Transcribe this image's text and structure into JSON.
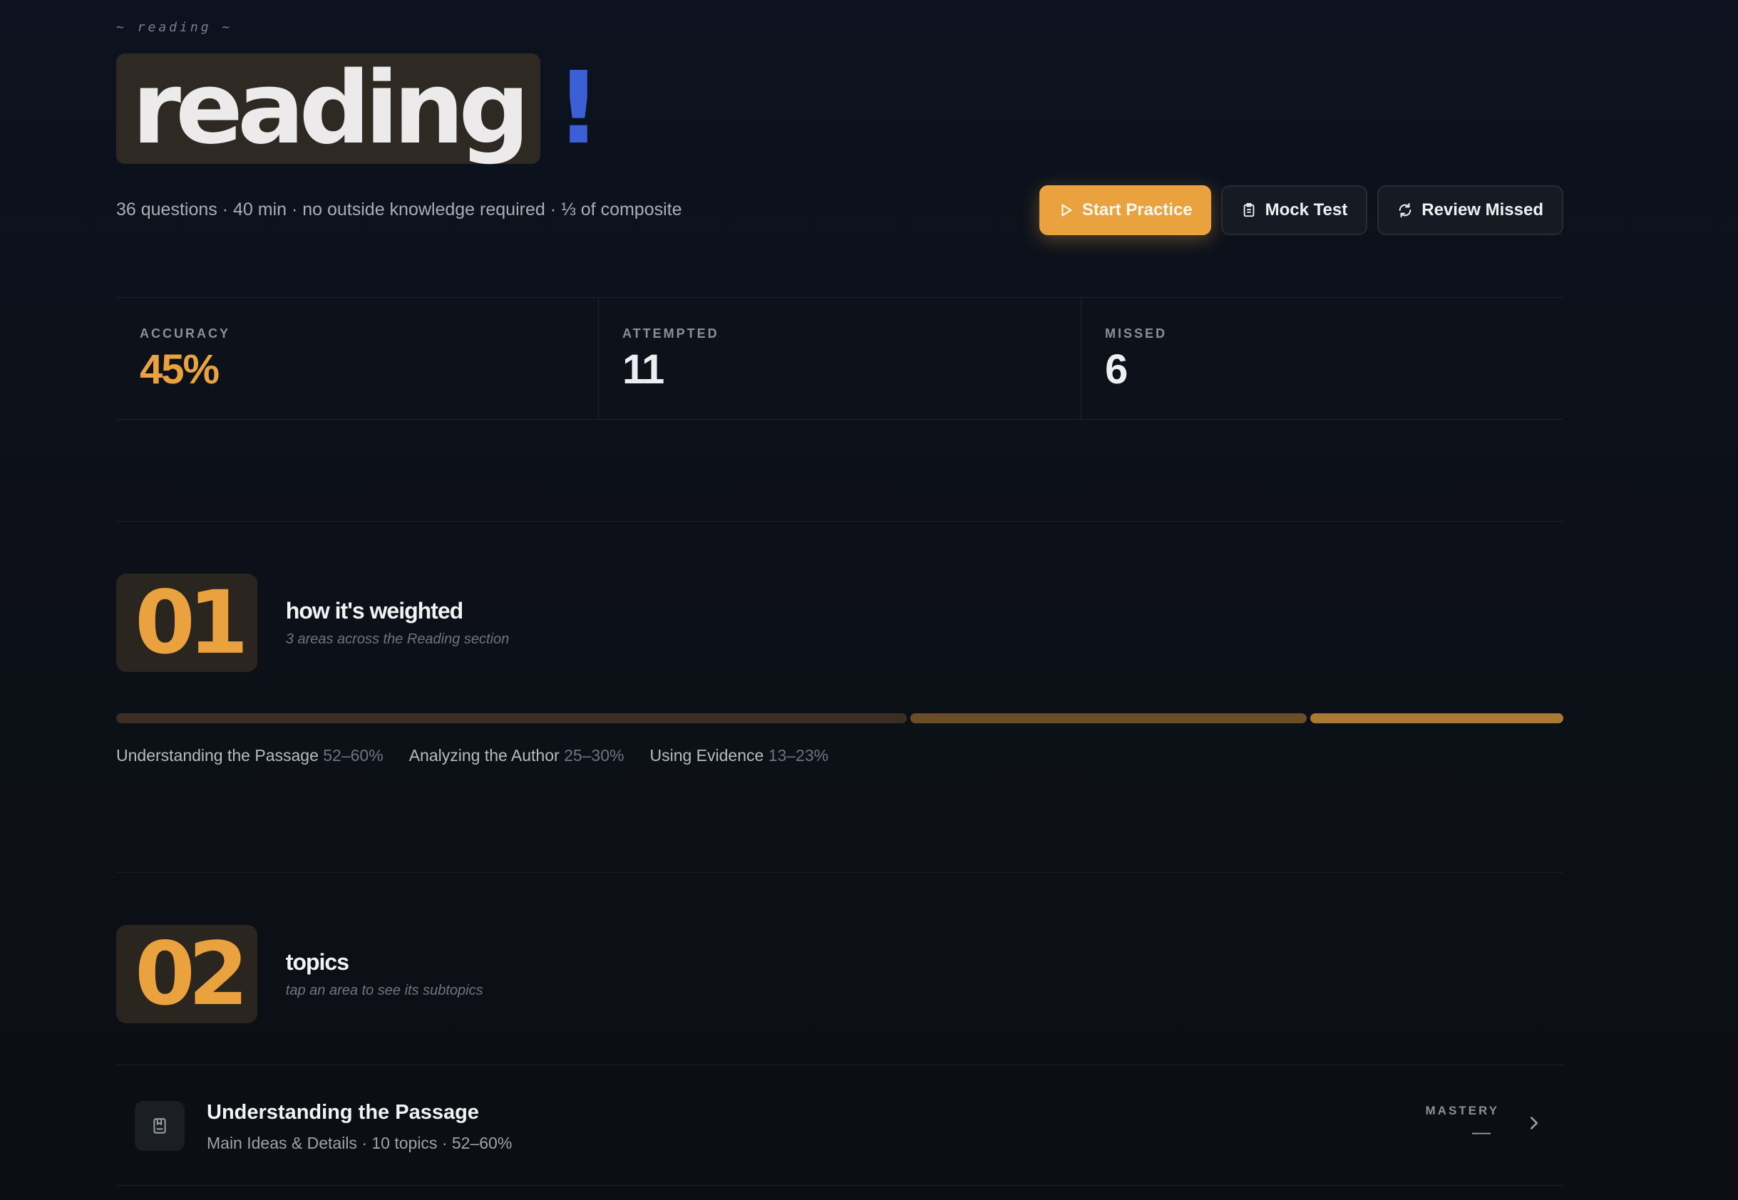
{
  "header": {
    "eyebrow": "~ reading ~",
    "title": "reading",
    "title_mark": "!",
    "meta": "36 questions · 40 min · no outside knowledge required · ⅓ of composite"
  },
  "actions": {
    "start_label": "Start Practice",
    "mock_label": "Mock Test",
    "review_label": "Review Missed"
  },
  "stats": {
    "accuracy_label": "ACCURACY",
    "accuracy_value": "45%",
    "attempted_label": "ATTEMPTED",
    "attempted_value": "11",
    "missed_label": "MISSED",
    "missed_value": "6"
  },
  "weighting": {
    "number": "01",
    "title": "how it's weighted",
    "subtitle": "3 areas across the Reading section",
    "areas": [
      {
        "name": "Understanding the Passage",
        "range": "52–60%"
      },
      {
        "name": "Analyzing the Author",
        "range": "25–30%"
      },
      {
        "name": "Using Evidence",
        "range": "13–23%"
      }
    ]
  },
  "topics": {
    "number": "02",
    "title": "topics",
    "subtitle": "tap an area to see its subtopics",
    "items": [
      {
        "title": "Understanding the Passage",
        "subtitle": "Main Ideas & Details · 10 topics · 52–60%",
        "mastery_label": "MASTERY",
        "mastery_value": "—",
        "icon": "bookmark-book-icon"
      }
    ]
  },
  "colors": {
    "accent": "#eaa23f",
    "mark": "#3b5fd6",
    "background": "#0c111b"
  }
}
